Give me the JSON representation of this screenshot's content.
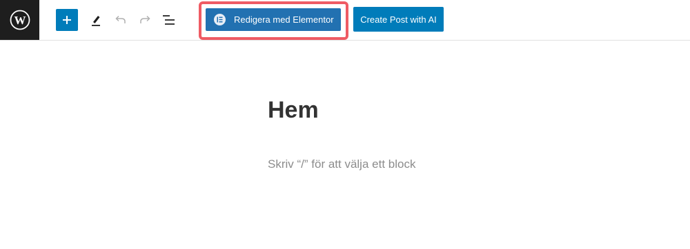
{
  "toolbar": {
    "logo_icon": "wordpress-logo-icon",
    "add_block_icon": "plus-icon",
    "tools_icon": "pencil-icon",
    "undo_icon": "undo-icon",
    "redo_icon": "redo-icon",
    "list_view_icon": "list-view-icon",
    "elementor_icon": "elementor-icon",
    "elementor_button_label": "Redigera med Elementor",
    "ai_button_label": "Create Post with AI"
  },
  "editor": {
    "title": "Hem",
    "block_placeholder": "Skriv “/” för att välja ett block"
  },
  "colors": {
    "accent": "#007cba",
    "elementor_button": "#2271b1",
    "highlight": "#ef5b64",
    "logo_background": "#1e1e1e"
  }
}
